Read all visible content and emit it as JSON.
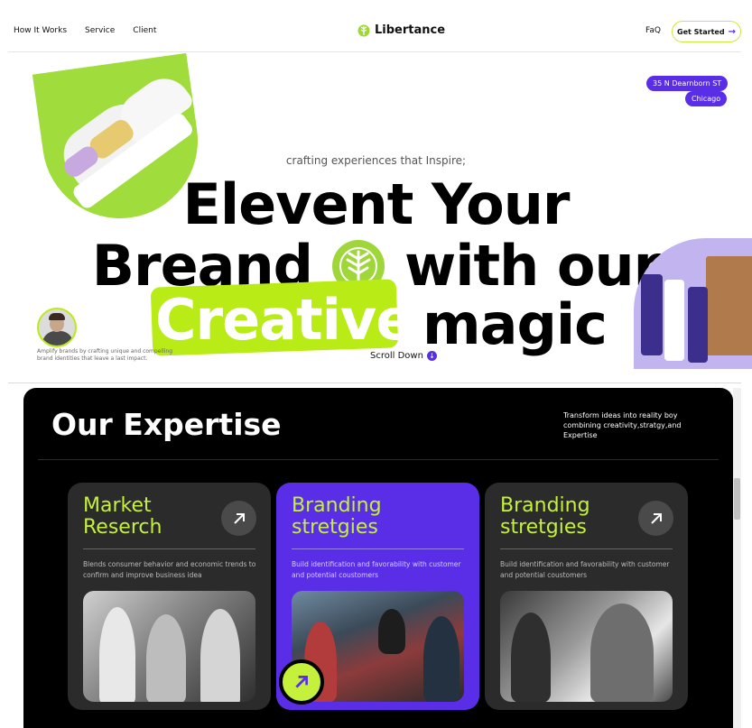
{
  "nav": {
    "links": [
      "How It Works",
      "Service",
      "Client"
    ],
    "logo_text": "Libertance",
    "faq": "FaQ",
    "cta_label": "Get Started",
    "cta_arrow": "→"
  },
  "hero": {
    "badge_street": "35 N Dearnborn ST",
    "badge_city": "Chicago",
    "tagline": "crafting experiences that Inspire;",
    "line1": "Elevent Your",
    "line2_left": "Breand",
    "line2_right": "with our",
    "creative": "Creative",
    "magic": "magic",
    "caption": "Amplify brands by crafting unique and compelling brand identities that leave a last impact.",
    "scroll_label": "Scroll Down",
    "scroll_icon": "↓"
  },
  "expertise": {
    "title": "Our Expertise",
    "description": "Transform ideas into reality boy combining creativity,stratgy,and Expertise",
    "cards": [
      {
        "title": "Market Reserch",
        "description": "Blends consumer behavior and economic trends to confirm and improve business idea",
        "icon": "arrow-up-right-icon"
      },
      {
        "title": "Branding stretgies",
        "description": "Build identification and favorability with customer and potential coustomers",
        "icon": "arrow-up-right-icon"
      },
      {
        "title": "Branding stretgies",
        "description": "Build identification and favorability with customer and potential coustomers",
        "icon": "arrow-up-right-icon"
      }
    ]
  },
  "colors": {
    "accent_purple": "#5a2ee6",
    "accent_lime": "#c5f03c",
    "dark": "#000000",
    "card": "#2b2b2b"
  }
}
